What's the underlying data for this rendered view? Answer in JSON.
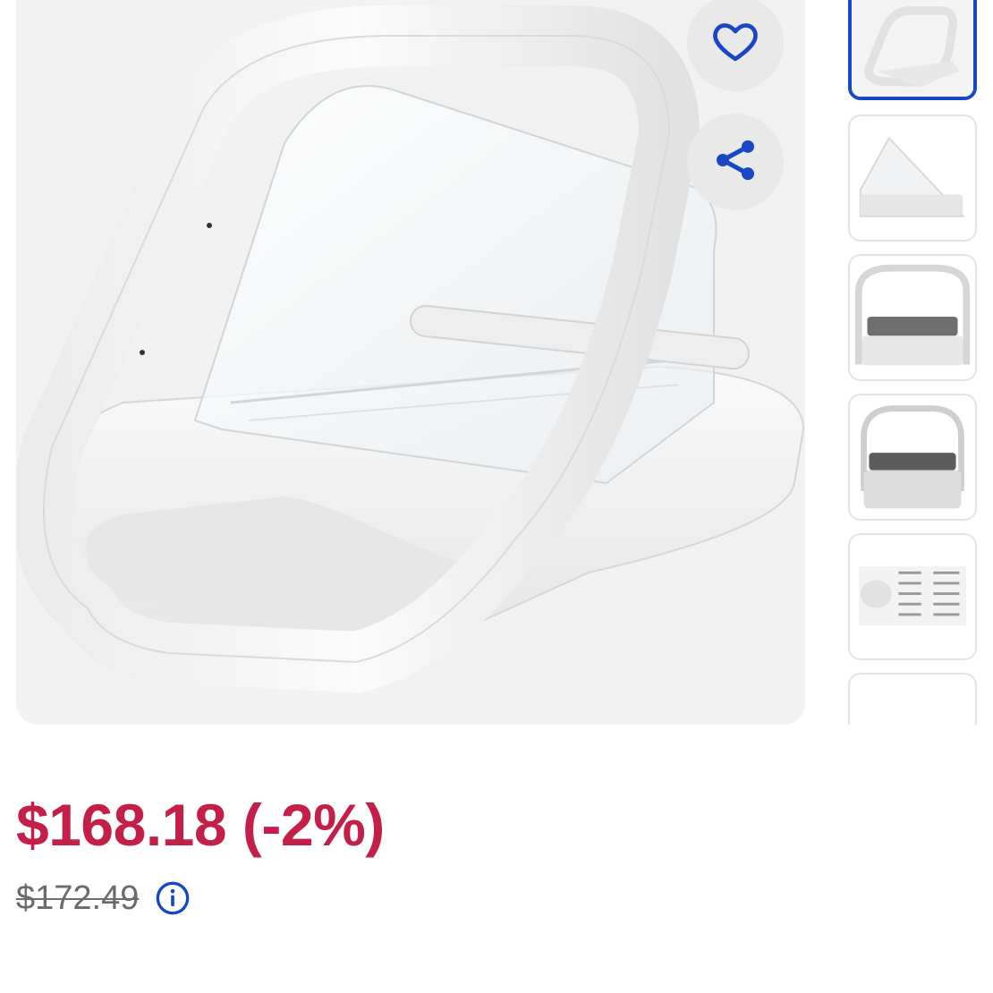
{
  "product": {
    "image_alt": "SureFeed microchip pet feeder",
    "main_image_icon": "pet-feeder-image"
  },
  "actions": {
    "favorite_icon": "heart-outline-icon",
    "share_icon": "share-icon"
  },
  "thumbnails": [
    {
      "icon": "feeder-front-thumbnail",
      "selected": true
    },
    {
      "icon": "feeder-side-thumbnail",
      "selected": false
    },
    {
      "icon": "feeder-front-open-thumbnail",
      "selected": false
    },
    {
      "icon": "feeder-front-bowl-thumbnail",
      "selected": false
    },
    {
      "icon": "feeder-instructions-thumbnail",
      "selected": false
    },
    {
      "icon": "feeder-thumbnail-partial",
      "selected": false
    }
  ],
  "pricing": {
    "current_price": "$168.18 (-2%)",
    "original_price": "$172.49",
    "info_icon": "info-circle-icon"
  },
  "colors": {
    "price_red": "#c31f48",
    "accent_blue": "#1846c4",
    "muted_gray": "#6b6b6b"
  }
}
